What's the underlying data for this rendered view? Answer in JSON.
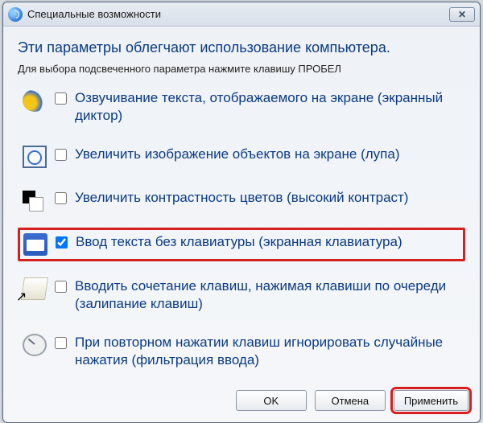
{
  "window": {
    "title": "Специальные возможности"
  },
  "heading": "Эти параметры облегчают использование компьютера.",
  "subheading": "Для выбора подсвеченного параметра нажмите клавишу ПРОБЕЛ",
  "options": [
    {
      "label": "Озвучивание текста, отображаемого на экране (экранный диктор)",
      "checked": false
    },
    {
      "label": "Увеличить изображение объектов на экране (лупа)",
      "checked": false
    },
    {
      "label": "Увеличить контрастность цветов (высокий контраст)",
      "checked": false
    },
    {
      "label": "Ввод текста без клавиатуры (экранная клавиатура)",
      "checked": true
    },
    {
      "label": "Вводить сочетание клавиш, нажимая клавиши по очереди (залипание клавиш)",
      "checked": false
    },
    {
      "label": "При повторном нажатии клавиш игнорировать случайные нажатия (фильтрация ввода)",
      "checked": false
    }
  ],
  "buttons": {
    "ok": "OK",
    "cancel": "Отмена",
    "apply": "Применить"
  }
}
